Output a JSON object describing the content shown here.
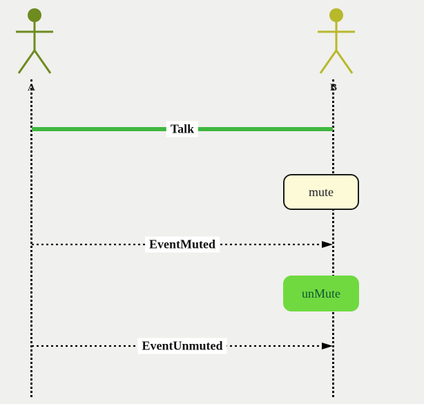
{
  "actors": {
    "a": {
      "label": "A",
      "color": "#6e8b1f"
    },
    "b": {
      "label": "B",
      "color": "#b8b82b"
    }
  },
  "messages": {
    "talk": {
      "label": "Talk"
    }
  },
  "nodes": {
    "mute": {
      "label": "mute"
    },
    "unmute": {
      "label": "unMute"
    }
  },
  "events": {
    "muted": {
      "label": "EventMuted"
    },
    "unmuted": {
      "label": "EventUnmuted"
    }
  }
}
